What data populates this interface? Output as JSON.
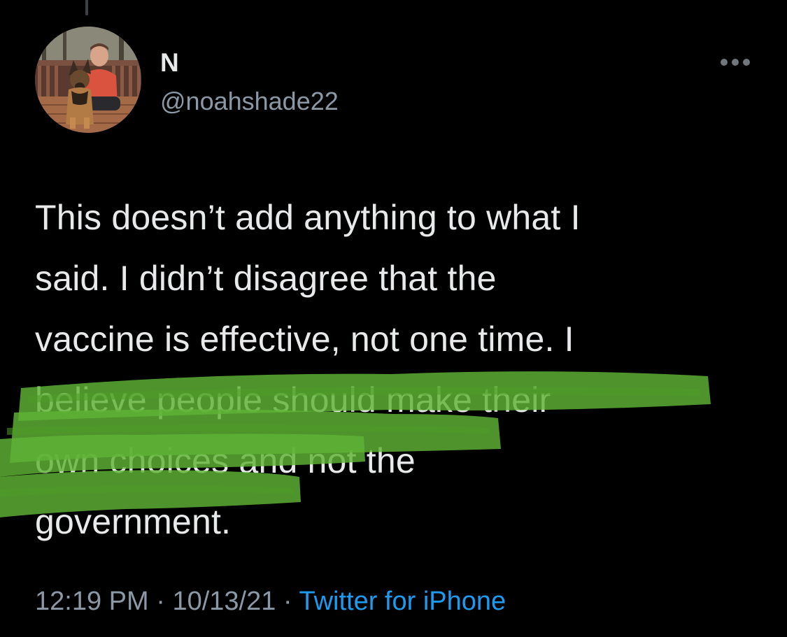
{
  "tweet": {
    "display_name": "N",
    "handle": "@noahshade22",
    "avatar_icon": "profile-photo-man-with-dog",
    "more_icon": "more-horizontal-icon",
    "text_lines": [
      "This doesn’t add anything to what I",
      "said. I didn’t disagree that the",
      "vaccine is effective, not one time. I",
      "believe people should make their",
      "own choices and not the",
      "government."
    ],
    "time": "12:19 PM",
    "date": "10/13/21",
    "separator": "·",
    "source": "Twitter for iPhone"
  },
  "colors": {
    "background": "#000000",
    "text_primary": "#e7e9ea",
    "text_secondary": "#8b98a5",
    "link": "#1d9bf0",
    "highlight": "#5fb336"
  }
}
